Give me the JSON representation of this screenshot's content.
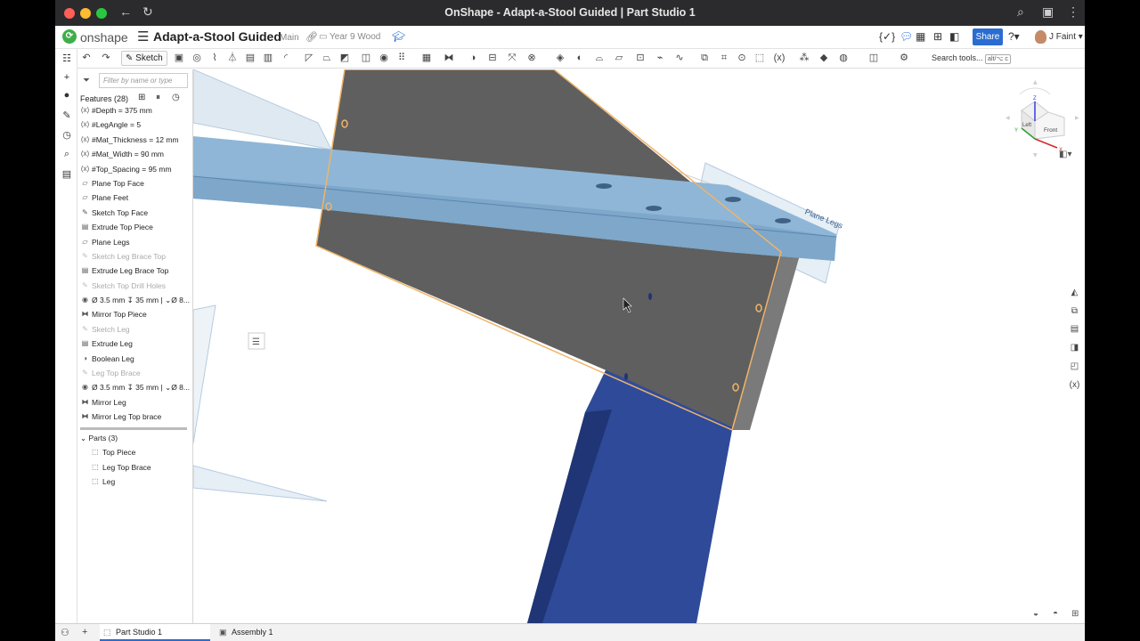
{
  "window": {
    "title": "OnShape - Adapt-a-Stool Guided | Part Studio 1"
  },
  "header": {
    "brand": "onshape",
    "doc_title": "Adapt-a-Stool Guided",
    "branch": "Main",
    "folder": "Year 9 Wood",
    "share_label": "Share",
    "user_name": "J Faint"
  },
  "toolbar": {
    "sketch_label": "Sketch",
    "search_label": "Search tools...",
    "search_shortcut": "alt/⌥ c"
  },
  "features": {
    "filter_placeholder": "Filter by name or type",
    "header": "Features (28)",
    "items": [
      {
        "label": "#Depth = 375 mm",
        "icon": "variable-icon",
        "suppressed": false
      },
      {
        "label": "#LegAngle = 5",
        "icon": "variable-icon",
        "suppressed": false
      },
      {
        "label": "#Mat_Thickness = 12 mm",
        "icon": "variable-icon",
        "suppressed": false
      },
      {
        "label": "#Mat_Width = 90 mm",
        "icon": "variable-icon",
        "suppressed": false
      },
      {
        "label": "#Top_Spacing = 95 mm",
        "icon": "variable-icon",
        "suppressed": false
      },
      {
        "label": "Plane Top Face",
        "icon": "plane-icon",
        "suppressed": false
      },
      {
        "label": "Plane Feet",
        "icon": "plane-icon",
        "suppressed": false
      },
      {
        "label": "Sketch Top Face",
        "icon": "sketch-icon",
        "suppressed": false
      },
      {
        "label": "Extrude Top Piece",
        "icon": "extrude-icon",
        "suppressed": false
      },
      {
        "label": "Plane Legs",
        "icon": "plane-icon",
        "suppressed": false
      },
      {
        "label": "Sketch Leg Brace Top",
        "icon": "sketch-icon",
        "suppressed": true
      },
      {
        "label": "Extrude Leg Brace Top",
        "icon": "extrude-icon",
        "suppressed": false
      },
      {
        "label": "Sketch Top Drill Holes",
        "icon": "sketch-icon",
        "suppressed": true
      },
      {
        "label": "Ø 3.5 mm ↧ 35 mm | ⌄Ø 8...",
        "icon": "hole-icon",
        "suppressed": false
      },
      {
        "label": "Mirror Top Piece",
        "icon": "mirror-icon",
        "suppressed": false
      },
      {
        "label": "Sketch Leg",
        "icon": "sketch-icon",
        "suppressed": true
      },
      {
        "label": "Extrude Leg",
        "icon": "extrude-icon",
        "suppressed": false
      },
      {
        "label": "Boolean Leg",
        "icon": "boolean-icon",
        "suppressed": false
      },
      {
        "label": "Leg Top Brace",
        "icon": "sketch-icon",
        "suppressed": true
      },
      {
        "label": "Ø 3.5 mm ↧ 35 mm | ⌄Ø 8...",
        "icon": "hole-icon",
        "suppressed": false
      },
      {
        "label": "Mirror Leg",
        "icon": "mirror-icon",
        "suppressed": false
      },
      {
        "label": "Mirror Leg Top brace",
        "icon": "mirror-icon",
        "suppressed": false
      }
    ]
  },
  "parts": {
    "header": "Parts (3)",
    "items": [
      "Top Piece",
      "Leg Top Brace",
      "Leg"
    ]
  },
  "viewport": {
    "plane_label": "Plane Legs",
    "cube_top": "Z",
    "cube_left": "Left",
    "cube_front": "Front",
    "axis_x": "X",
    "axis_y": "Y"
  },
  "tabs": [
    {
      "label": "Part Studio 1",
      "active": true
    },
    {
      "label": "Assembly 1",
      "active": false
    }
  ],
  "colors": {
    "accent": "#2b6cd1",
    "leg_blue": "#2f4b9a",
    "top_blue": "#8fb6d6",
    "brace_grey": "#5e5e5e",
    "selection_orange": "#f0b46a"
  }
}
